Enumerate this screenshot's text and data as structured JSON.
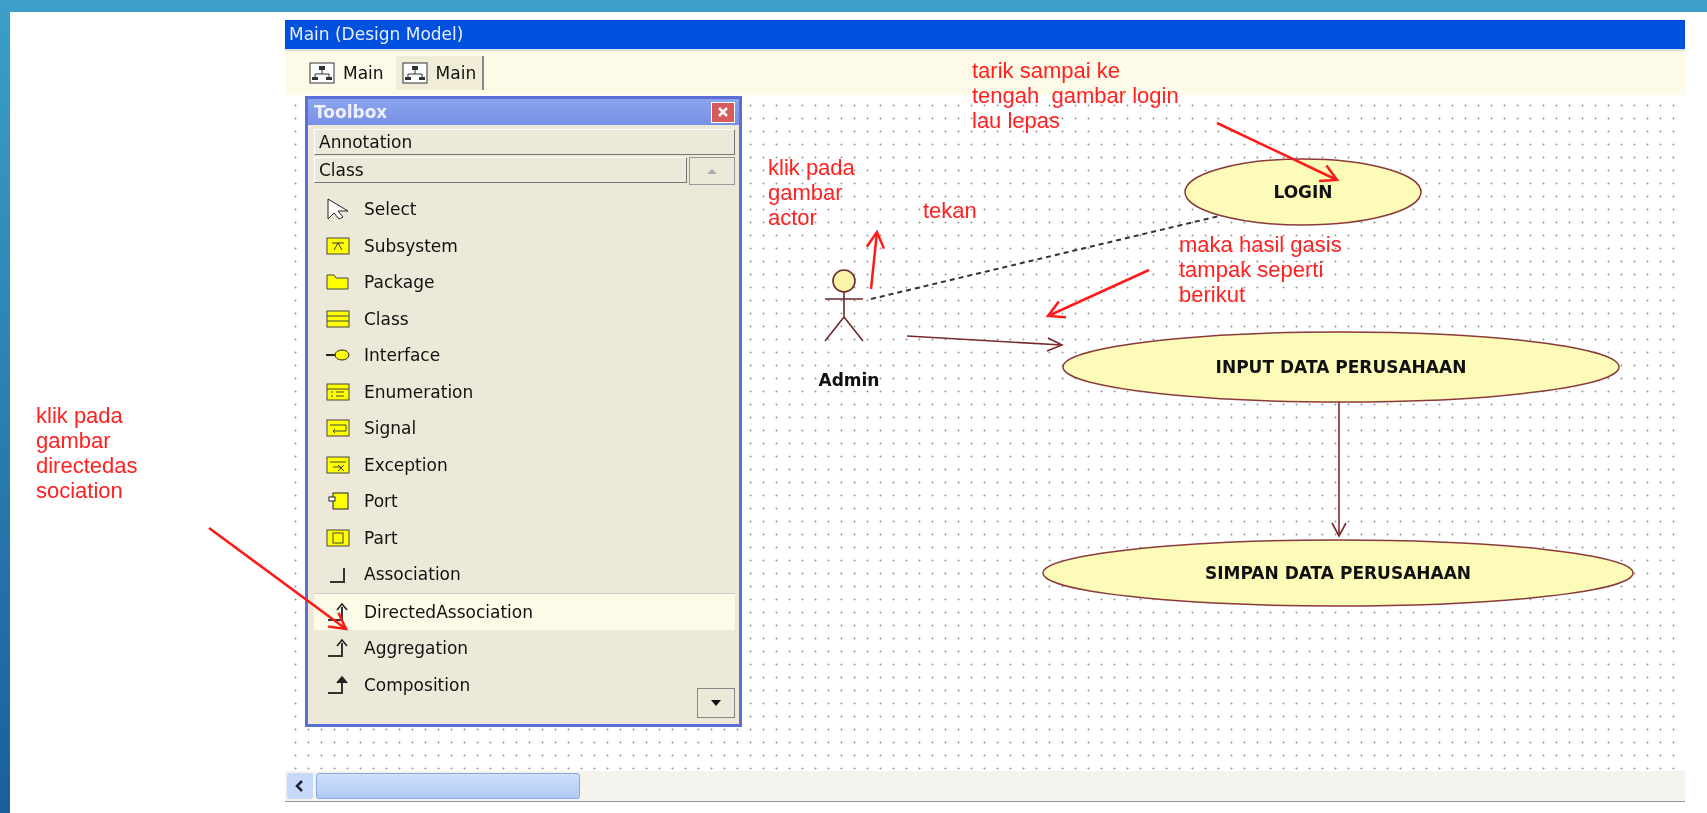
{
  "window": {
    "title": "Main (Design Model)"
  },
  "tabs": [
    {
      "label": "Main",
      "selected": true
    },
    {
      "label": "Main",
      "selected": false
    }
  ],
  "toolbox": {
    "title": "Toolbox",
    "sections": [
      "Annotation",
      "Class"
    ],
    "items": [
      {
        "label": "Select",
        "kind": "select",
        "selected": false
      },
      {
        "label": "Subsystem",
        "kind": "subsystem",
        "selected": false
      },
      {
        "label": "Package",
        "kind": "package",
        "selected": false
      },
      {
        "label": "Class",
        "kind": "class",
        "selected": false
      },
      {
        "label": "Interface",
        "kind": "interface",
        "selected": false
      },
      {
        "label": "Enumeration",
        "kind": "enumeration",
        "selected": false
      },
      {
        "label": "Signal",
        "kind": "signal",
        "selected": false
      },
      {
        "label": "Exception",
        "kind": "exception",
        "selected": false
      },
      {
        "label": "Port",
        "kind": "port",
        "selected": false
      },
      {
        "label": "Part",
        "kind": "part",
        "selected": false
      },
      {
        "label": "Association",
        "kind": "association",
        "selected": false
      },
      {
        "label": "DirectedAssociation",
        "kind": "directed",
        "selected": true
      },
      {
        "label": "Aggregation",
        "kind": "aggregation",
        "selected": false
      },
      {
        "label": "Composition",
        "kind": "composition",
        "selected": false
      }
    ]
  },
  "diagram": {
    "actor": "Admin",
    "use_cases": [
      "LOGIN",
      "INPUT DATA PERUSAHAAN",
      "SIMPAN DATA PERUSAHAAN"
    ]
  },
  "annotations": [
    "tarik sampai ke\ntengah  gambar login\nlau lepas",
    "klik pada\ngambar\nactor",
    "tekan",
    "maka hasil gasis\ntampak seperti\nberikut",
    "klik pada\ngambar\ndirectedas\nsociation"
  ]
}
